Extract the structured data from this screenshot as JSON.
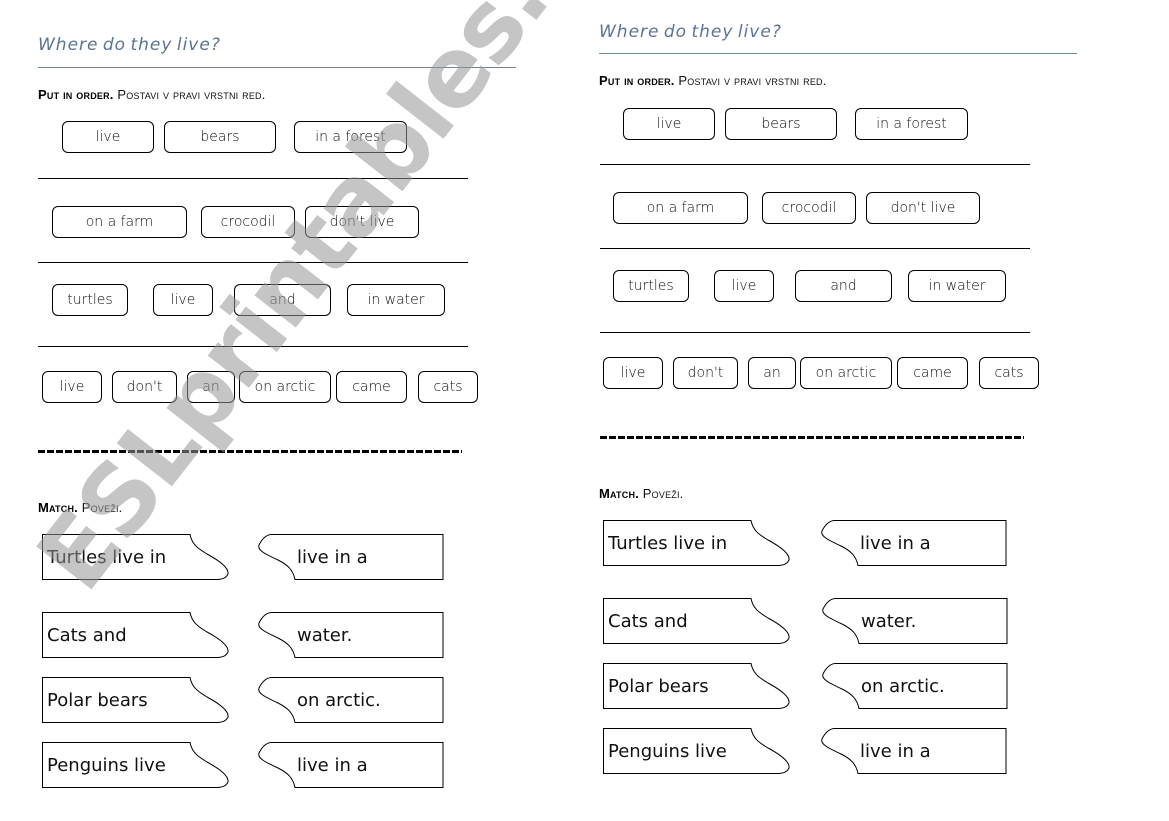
{
  "worksheet": {
    "title": "Where do they live?",
    "put_in_order": {
      "label_bold": "Put in order.",
      "label_plain": "Postavi v pravi vrstni red.",
      "rows": [
        [
          "live",
          "bears",
          "in a forest"
        ],
        [
          "on a farm",
          "crocodil",
          "don't live"
        ],
        [
          "turtles",
          "live",
          "and",
          "in water"
        ],
        [
          "live",
          "don't",
          "an",
          "on arctic",
          "came",
          "cats"
        ]
      ]
    },
    "match": {
      "label_bold": "Match.",
      "label_plain": "Poveži.",
      "left_pieces": [
        "Turtles  live  in",
        "Cats  and",
        "Polar bears",
        "Penguins live"
      ],
      "right_pieces": [
        "live  in a",
        "water.",
        "on arctic.",
        "live in a"
      ]
    }
  },
  "watermark": "ESLprintables.com",
  "colors": {
    "title": "#5a7496",
    "rule": "#6e86a6",
    "ink": "#000000",
    "watermark": "#969696"
  }
}
